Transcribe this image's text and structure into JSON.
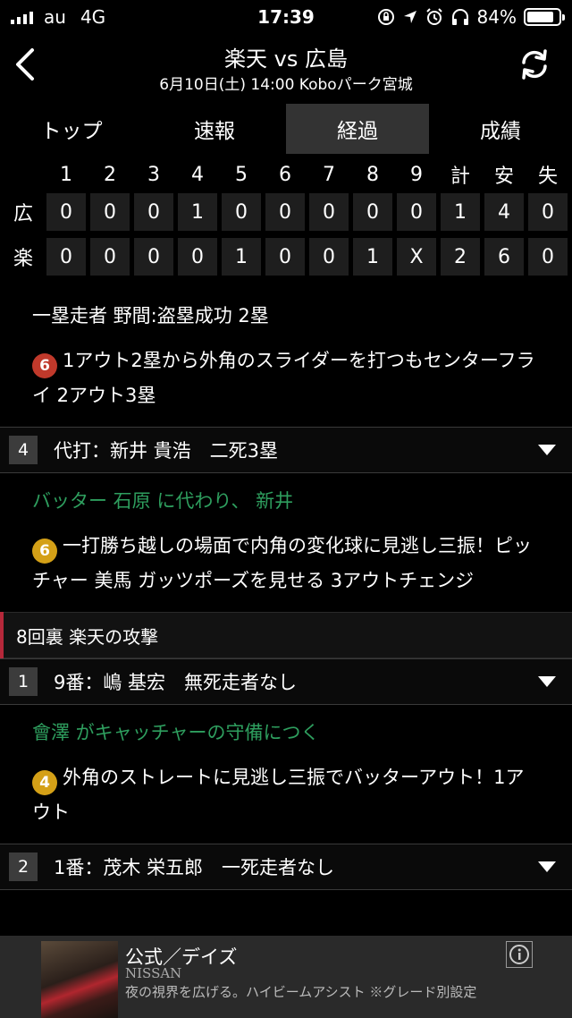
{
  "status": {
    "carrier": "au",
    "network": "4G",
    "time": "17:39",
    "battery": "84%",
    "battery_level": 0.84
  },
  "header": {
    "title": "楽天 vs 広島",
    "subtitle": "6月10日(土) 14:00 Koboパーク宮城"
  },
  "tabs": [
    {
      "label": "トップ",
      "active": false
    },
    {
      "label": "速報",
      "active": false
    },
    {
      "label": "経過",
      "active": true
    },
    {
      "label": "成績",
      "active": false
    }
  ],
  "scoreboard": {
    "columns": [
      "1",
      "2",
      "3",
      "4",
      "5",
      "6",
      "7",
      "8",
      "9",
      "計",
      "安",
      "失"
    ],
    "rows": [
      {
        "team": "広",
        "cells": [
          "0",
          "0",
          "0",
          "1",
          "0",
          "0",
          "0",
          "0",
          "0",
          "1",
          "4",
          "0"
        ]
      },
      {
        "team": "楽",
        "cells": [
          "0",
          "0",
          "0",
          "0",
          "1",
          "0",
          "0",
          "1",
          "X",
          "2",
          "6",
          "0"
        ]
      }
    ]
  },
  "feed": {
    "p1": "一塁走者 野間:盗塁成功 2塁",
    "p2_badge": "6",
    "p2": "1アウト2塁から外角のスライダーを打つもセンターフライ 2アウト3塁",
    "batter4_num": "4",
    "batter4": "代打：新井 貴浩　二死3塁",
    "p3": "バッター 石原 に代わり、 新井",
    "p4_badge": "6",
    "p4": "一打勝ち越しの場面で内角の変化球に見逃し三振！ピッチャー 美馬 ガッツポーズを見せる 3アウトチェンジ",
    "inning": "8回裏 楽天の攻撃",
    "batter1_num": "1",
    "batter1": "9番：嶋 基宏　無死走者なし",
    "p5": "會澤 がキャッチャーの守備につく",
    "p6_badge": "4",
    "p6": "外角のストレートに見逃し三振でバッターアウト！1アウト",
    "batter2_num": "2",
    "batter2": "1番：茂木 栄五郎　一死走者なし"
  },
  "ad": {
    "title": "公式／デイズ",
    "brand": "NISSAN",
    "copy": "夜の視界を広げる。ハイビームアシスト ※グレード別設定"
  }
}
